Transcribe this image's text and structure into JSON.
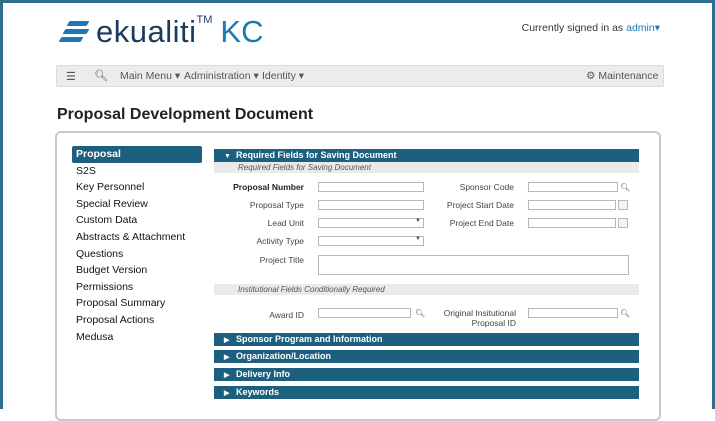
{
  "header": {
    "logo_text": "ekualiti",
    "logo_tm": "TM",
    "logo_kc": "KC",
    "signed_in_text": "Currently signed in as",
    "signed_in_user": "admin",
    "user_caret": "▾"
  },
  "navbar": {
    "menu_icon": "list-icon",
    "search_icon": "search-icon",
    "main_menu": "Main Menu",
    "administration": "Administration",
    "identity": "Identity",
    "caret": "▾",
    "maintenance": "Maintenance",
    "maintenance_icon": "gear-icon"
  },
  "page": {
    "title": "Proposal Development Document"
  },
  "sidebar": {
    "items": [
      {
        "label": "Proposal",
        "active": true
      },
      {
        "label": "S2S"
      },
      {
        "label": "Key Personnel"
      },
      {
        "label": "Special Review"
      },
      {
        "label": "Custom Data"
      },
      {
        "label": "Abstracts & Attachment"
      },
      {
        "label": "Questions"
      },
      {
        "label": "Budget Version"
      },
      {
        "label": "Permissions"
      },
      {
        "label": "Proposal Summary"
      },
      {
        "label": "Proposal Actions"
      },
      {
        "label": "Medusa"
      }
    ]
  },
  "sections": {
    "required": {
      "title": "Required Fields for Saving Document",
      "subtitle": "Required Fields for Saving Document",
      "expanded": true
    },
    "institutional_subtitle": "Institutional Fields Conditionally Required",
    "collapsed": [
      "Sponsor Program and Information",
      "Organization/Location",
      "Delivery Info",
      "Keywords"
    ]
  },
  "form": {
    "proposal_number": {
      "label": "Proposal Number",
      "value": ""
    },
    "sponsor_code": {
      "label": "Sponsor Code",
      "value": ""
    },
    "proposal_type": {
      "label": "Proposal Type",
      "value": ""
    },
    "project_start_date": {
      "label": "Project Start Date",
      "value": ""
    },
    "lead_unit": {
      "label": "Lead Unit",
      "value": ""
    },
    "project_end_date": {
      "label": "Project End Date",
      "value": ""
    },
    "activity_type": {
      "label": "Activity Type",
      "value": ""
    },
    "project_title": {
      "label": "Project Title",
      "value": ""
    },
    "award_id": {
      "label": "Award ID",
      "value": ""
    },
    "original_institutional_proposal_id": {
      "label_line1": "Original Insitutional",
      "label_line2": "Proposal ID",
      "value": ""
    }
  },
  "colors": {
    "section_header": "#1c5f7e",
    "brand_blue": "#1a7ab8",
    "brand_dark": "#1b3a5c",
    "frame": "#2e6e8e"
  }
}
